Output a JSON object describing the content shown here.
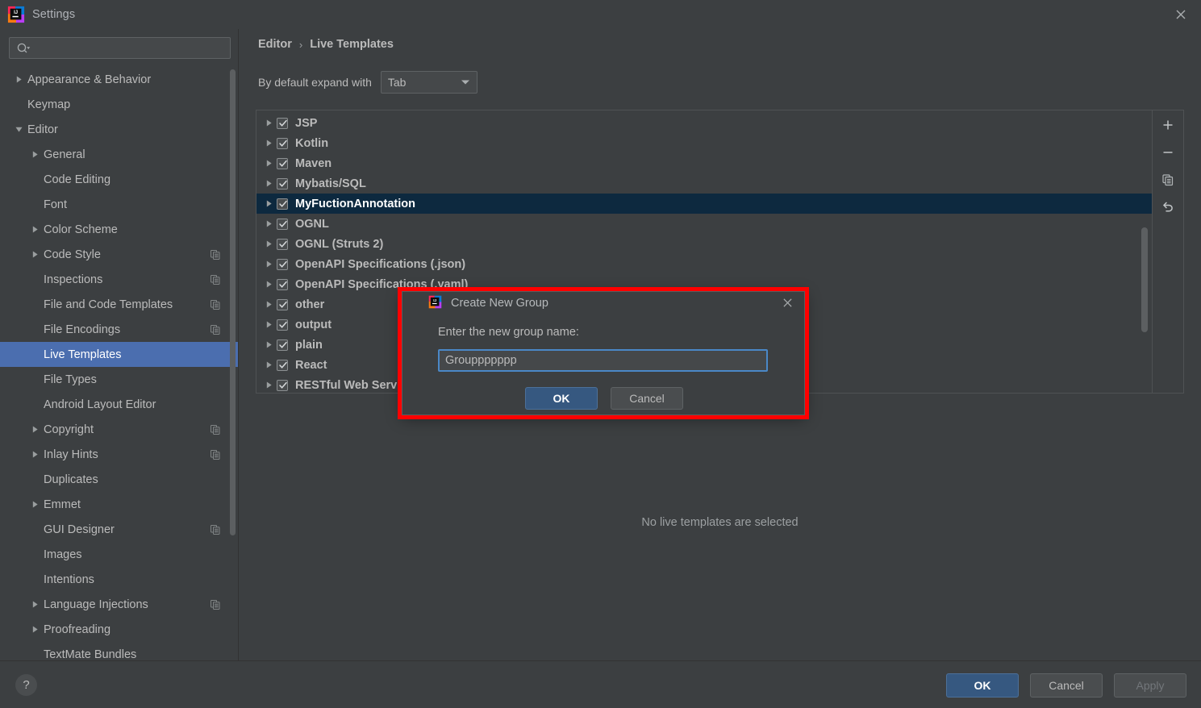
{
  "window": {
    "title": "Settings",
    "logo_icon": "intellij-idea-logo",
    "close_icon": "close-icon"
  },
  "search": {
    "value": "",
    "placeholder": "",
    "icon": "search-icon"
  },
  "sidebar": {
    "items": [
      {
        "label": "Appearance & Behavior",
        "level": 0,
        "arrow": "collapsed",
        "copy": false,
        "selected": false
      },
      {
        "label": "Keymap",
        "level": 0,
        "arrow": "none",
        "copy": false,
        "selected": false
      },
      {
        "label": "Editor",
        "level": 0,
        "arrow": "expanded",
        "copy": false,
        "selected": false
      },
      {
        "label": "General",
        "level": 1,
        "arrow": "collapsed",
        "copy": false,
        "selected": false
      },
      {
        "label": "Code Editing",
        "level": 1,
        "arrow": "none",
        "copy": false,
        "selected": false
      },
      {
        "label": "Font",
        "level": 1,
        "arrow": "none",
        "copy": false,
        "selected": false
      },
      {
        "label": "Color Scheme",
        "level": 1,
        "arrow": "collapsed",
        "copy": false,
        "selected": false
      },
      {
        "label": "Code Style",
        "level": 1,
        "arrow": "collapsed",
        "copy": true,
        "selected": false
      },
      {
        "label": "Inspections",
        "level": 1,
        "arrow": "none",
        "copy": true,
        "selected": false
      },
      {
        "label": "File and Code Templates",
        "level": 1,
        "arrow": "none",
        "copy": true,
        "selected": false
      },
      {
        "label": "File Encodings",
        "level": 1,
        "arrow": "none",
        "copy": true,
        "selected": false
      },
      {
        "label": "Live Templates",
        "level": 1,
        "arrow": "none",
        "copy": false,
        "selected": true
      },
      {
        "label": "File Types",
        "level": 1,
        "arrow": "none",
        "copy": false,
        "selected": false
      },
      {
        "label": "Android Layout Editor",
        "level": 1,
        "arrow": "none",
        "copy": false,
        "selected": false
      },
      {
        "label": "Copyright",
        "level": 1,
        "arrow": "collapsed",
        "copy": true,
        "selected": false
      },
      {
        "label": "Inlay Hints",
        "level": 1,
        "arrow": "collapsed",
        "copy": true,
        "selected": false
      },
      {
        "label": "Duplicates",
        "level": 1,
        "arrow": "none",
        "copy": false,
        "selected": false
      },
      {
        "label": "Emmet",
        "level": 1,
        "arrow": "collapsed",
        "copy": false,
        "selected": false
      },
      {
        "label": "GUI Designer",
        "level": 1,
        "arrow": "none",
        "copy": true,
        "selected": false
      },
      {
        "label": "Images",
        "level": 1,
        "arrow": "none",
        "copy": false,
        "selected": false
      },
      {
        "label": "Intentions",
        "level": 1,
        "arrow": "none",
        "copy": false,
        "selected": false
      },
      {
        "label": "Language Injections",
        "level": 1,
        "arrow": "collapsed",
        "copy": true,
        "selected": false
      },
      {
        "label": "Proofreading",
        "level": 1,
        "arrow": "collapsed",
        "copy": false,
        "selected": false
      },
      {
        "label": "TextMate Bundles",
        "level": 1,
        "arrow": "none",
        "copy": false,
        "selected": false
      }
    ]
  },
  "main": {
    "breadcrumb": {
      "parent": "Editor",
      "separator": "›",
      "current": "Live Templates"
    },
    "expand_with": {
      "label": "By default expand with",
      "value": "Tab"
    },
    "empty_message": "No live templates are selected",
    "templates": [
      {
        "label": "JSP",
        "checked": true,
        "selected": false
      },
      {
        "label": "Kotlin",
        "checked": true,
        "selected": false
      },
      {
        "label": "Maven",
        "checked": true,
        "selected": false
      },
      {
        "label": "Mybatis/SQL",
        "checked": true,
        "selected": false
      },
      {
        "label": "MyFuctionAnnotation",
        "checked": true,
        "selected": true
      },
      {
        "label": "OGNL",
        "checked": true,
        "selected": false
      },
      {
        "label": "OGNL (Struts 2)",
        "checked": true,
        "selected": false
      },
      {
        "label": "OpenAPI Specifications (.json)",
        "checked": true,
        "selected": false
      },
      {
        "label": "OpenAPI Specifications (.yaml)",
        "checked": true,
        "selected": false
      },
      {
        "label": "other",
        "checked": true,
        "selected": false
      },
      {
        "label": "output",
        "checked": true,
        "selected": false
      },
      {
        "label": "plain",
        "checked": true,
        "selected": false
      },
      {
        "label": "React",
        "checked": true,
        "selected": false
      },
      {
        "label": "RESTful Web Service",
        "checked": true,
        "selected": false
      }
    ],
    "toolbar": [
      {
        "icon": "add-icon",
        "tooltip": "Add"
      },
      {
        "icon": "remove-icon",
        "tooltip": "Remove"
      },
      {
        "icon": "duplicate-icon",
        "tooltip": "Duplicate"
      },
      {
        "icon": "revert-icon",
        "tooltip": "Revert"
      }
    ]
  },
  "dialog": {
    "title": "Create New Group",
    "logo_icon": "intellij-idea-logo",
    "close_icon": "close-icon",
    "label": "Enter the new group name:",
    "input_value": "Grouppppppp",
    "ok_label": "OK",
    "cancel_label": "Cancel",
    "highlight_color": "#ff0000"
  },
  "bottom": {
    "help_label": "?",
    "ok_label": "OK",
    "cancel_label": "Cancel",
    "apply_label": "Apply"
  },
  "colors": {
    "background": "#3c3f41",
    "accent": "#365880",
    "selection_sidebar": "#4b6eaf",
    "selection_list": "#0d293f",
    "focus_border": "#4a88c7",
    "highlight": "#ff0000"
  }
}
